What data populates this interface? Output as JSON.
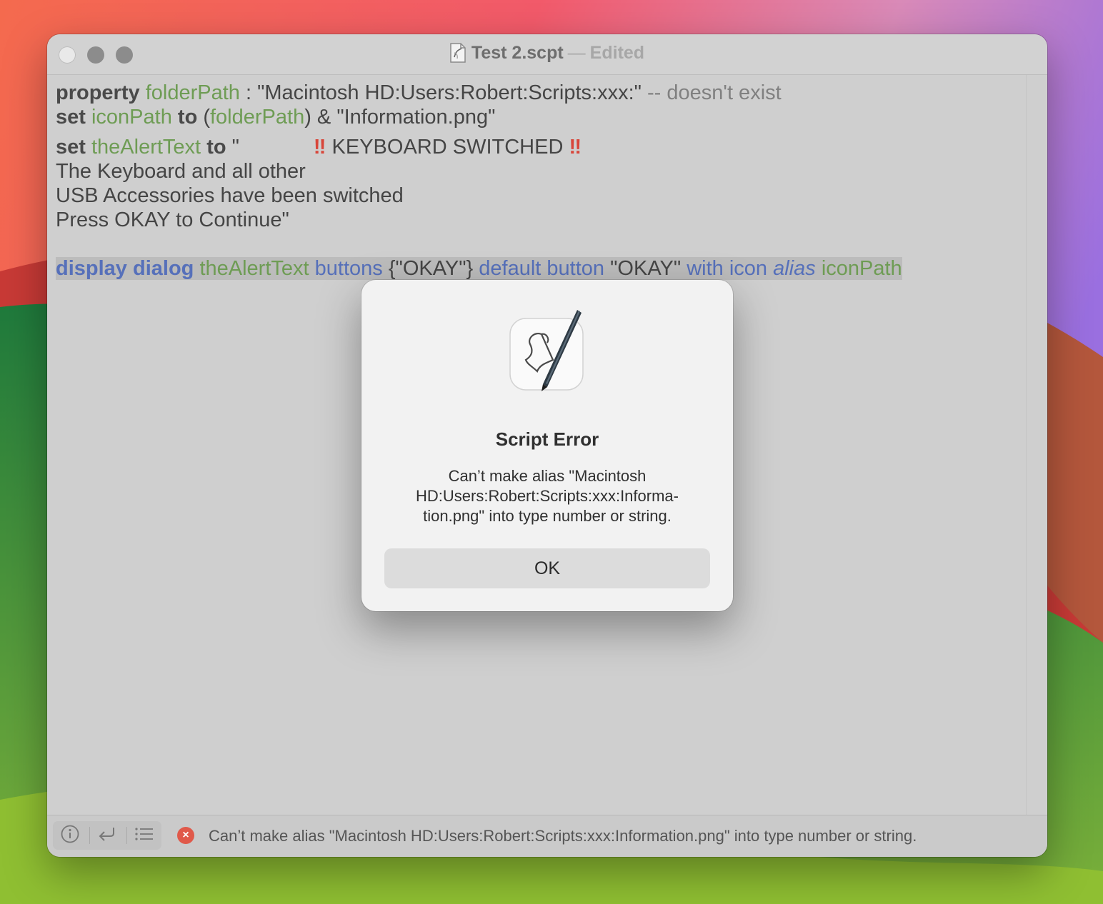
{
  "window": {
    "title": "Test 2.scpt",
    "title_separator": "—",
    "edited_label": "Edited"
  },
  "editor": {
    "line1": {
      "kw_property": "property",
      "var_folderPath": "folderPath",
      "colon": " : ",
      "value": "\"Macintosh HD:Users:Robert:Scripts:xxx:\"",
      "comment": " -- doesn't exist"
    },
    "line2": {
      "kw_set": "set",
      "var_iconPath": "iconPath",
      "kw_to": "to",
      "paren_open": " (",
      "var_folderPath": "folderPath",
      "rest": ") & \"Information.png\""
    },
    "line3": {
      "kw_set": "set",
      "var_theAlertText": "theAlertText",
      "kw_to": "to",
      "quote": " \"",
      "bang_left": "‼",
      "heading": " KEYBOARD SWITCHED ",
      "bang_right": "‼"
    },
    "line4": "The Keyboard and all other",
    "line5": "USB Accessories have been switched",
    "line6": "Press OKAY to Continue\"",
    "line8": {
      "cmd_display_dialog": "display dialog",
      "var_theAlertText": "theAlertText",
      "cls_buttons": "buttons",
      "buttons_list": " {\"OKAY\"} ",
      "cls_default_button": "default button",
      "default_value": " \"OKAY\" ",
      "cls_with_icon": "with icon",
      "it_alias": "alias",
      "var_iconPath": "iconPath"
    }
  },
  "statusbar": {
    "message": "Can’t make alias \"Macintosh HD:Users:Robert:Scripts:xxx:Information.png\" into type number or string."
  },
  "dialog": {
    "title": "Script Error",
    "message_line1": "Can’t make alias \"Macintosh",
    "message_line2": "HD:Users:Robert:Scripts:xxx:Informa-",
    "message_line3": "tion.png\" into type number or string.",
    "ok_label": "OK"
  },
  "colors": {
    "keyword": "#4a4a4a",
    "variable": "#6e9c54",
    "command": "#5670ba",
    "comment": "#808080",
    "error": "#e0594a"
  },
  "icons": [
    "script-editor-doc-icon",
    "info-icon",
    "return-arrow-icon",
    "list-icon",
    "error-icon",
    "script-editor-app-icon"
  ]
}
